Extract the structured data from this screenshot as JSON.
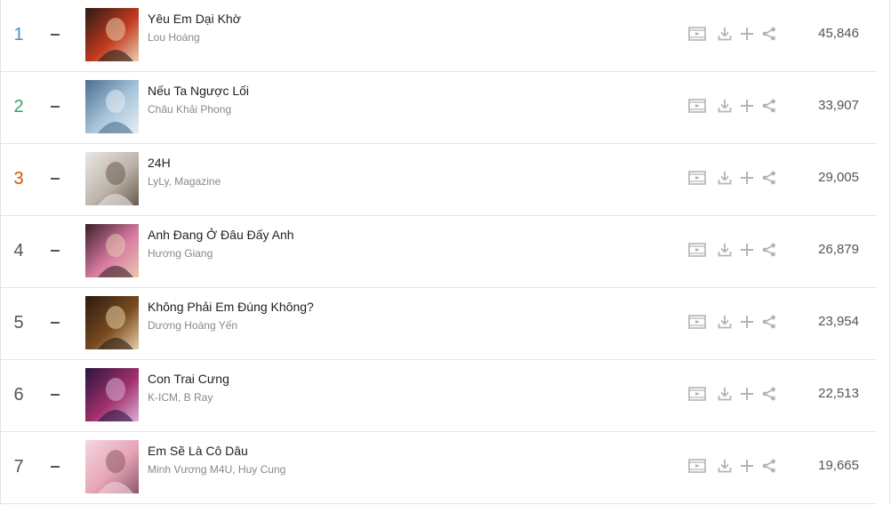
{
  "colors": {
    "rank_1": "#4a90c4",
    "rank_2": "#2ea76e",
    "rank_3": "#d35400",
    "rank_default": "#555555",
    "icon": "#b4b4b4"
  },
  "rows": [
    {
      "rank": "1",
      "trend": "–",
      "title": "Yêu Em Dại Khờ",
      "artist": "Lou Hoàng",
      "views": "45,846",
      "thumb_colors": [
        "#2a1a14",
        "#c23a1e",
        "#e8d0b0"
      ]
    },
    {
      "rank": "2",
      "trend": "–",
      "title": "Nếu Ta Ngược Lối",
      "artist": "Châu Khải Phong",
      "views": "33,907",
      "thumb_colors": [
        "#4a6f8f",
        "#a9c6dc",
        "#e8eef2"
      ]
    },
    {
      "rank": "3",
      "trend": "–",
      "title": "24H",
      "artist": "LyLy, Magazine",
      "views": "29,005",
      "thumb_colors": [
        "#e9e6e2",
        "#bdb5ac",
        "#6b5a4d"
      ]
    },
    {
      "rank": "4",
      "trend": "–",
      "title": "Anh Đang Ở Đâu Đấy Anh",
      "artist": "Hương Giang",
      "views": "26,879",
      "thumb_colors": [
        "#3a1f2a",
        "#d87aa0",
        "#e9c8b0"
      ]
    },
    {
      "rank": "5",
      "trend": "–",
      "title": "Không Phải Em Đúng Không?",
      "artist": "Dương Hoàng Yến",
      "views": "23,954",
      "thumb_colors": [
        "#2a1a10",
        "#7a4a1e",
        "#e6cfa8"
      ]
    },
    {
      "rank": "6",
      "trend": "–",
      "title": "Con Trai Cưng",
      "artist": "K-ICM, B Ray",
      "views": "22,513",
      "thumb_colors": [
        "#2b1440",
        "#a0306a",
        "#d8b0d8"
      ]
    },
    {
      "rank": "7",
      "trend": "–",
      "title": "Em Sẽ Là Cô Dâu",
      "artist": "Minh Vương M4U, Huy Cung",
      "views": "19,665",
      "thumb_colors": [
        "#f4d6de",
        "#e7a4b6",
        "#8a5a6a"
      ]
    }
  ],
  "icons": [
    "video-icon",
    "download-icon",
    "add-icon",
    "share-icon"
  ]
}
